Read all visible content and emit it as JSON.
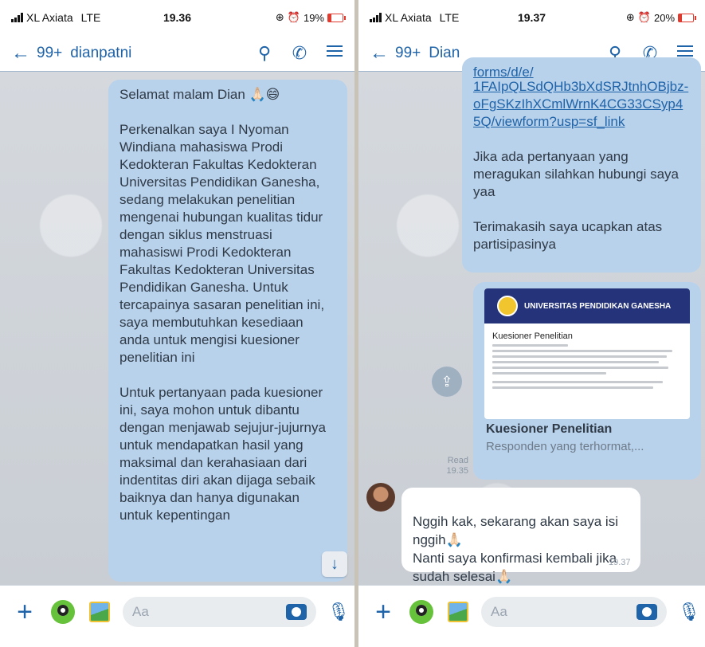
{
  "left": {
    "status": {
      "carrier": "XL Axiata",
      "network": "LTE",
      "time": "19.36",
      "battery": "19%"
    },
    "header": {
      "back_count": "99+",
      "contact": "dianpatni"
    },
    "messages": [
      "Selamat malam Dian 🙏🏻😄",
      "Perkenalkan saya I Nyoman Windiana mahasiswa Prodi Kedokteran Fakultas Kedokteran Universitas Pendidikan Ganesha, sedang melakukan penelitian mengenai hubungan kualitas tidur dengan siklus menstruasi mahasiswi Prodi Kedokteran Fakultas Kedokteran Universitas Pendidikan Ganesha. Untuk tercapainya sasaran penelitian ini, saya membutuhkan kesediaan anda untuk mengisi kuesioner penelitian ini",
      "Untuk pertanyaan pada kuesioner ini, saya mohon untuk dibantu dengan menjawab sejujur-jujurnya untuk mendapatkan hasil yang maksimal dan kerahasiaan dari indentitas diri akan dijaga sebaik baiknya dan hanya digunakan untuk kepentingan"
    ],
    "compose": {
      "placeholder": "Aa"
    }
  },
  "right": {
    "status": {
      "carrier": "XL Axiata",
      "network": "LTE",
      "time": "19.37",
      "battery": "20%"
    },
    "header": {
      "back_count": "99+",
      "contact": "Dian"
    },
    "messages": {
      "link_partial_top": "forms/d/e/",
      "link": "1FAIpQLSdQHb3bXdSRJtnhOBjbz-oFgSKzIhXCmlWrnK4CG33CSyp45Q/viewform?usp=sf_link",
      "para1": "Jika ada pertanyaan yang meragukan silahkan hubungi saya yaa",
      "para2": "Terimakasih saya ucapkan atas partisipasinya"
    },
    "card": {
      "banner": "UNIVERSITAS PENDIDIKAN GANESHA",
      "doc_title": "Kuesioner Penelitian",
      "title": "Kuesioner Penelitian",
      "subtitle": "Responden yang terhormat,..."
    },
    "receipt": {
      "label": "Read",
      "time": "19.35"
    },
    "reply": {
      "text": "Nggih kak, sekarang akan saya isi nggih🙏🏻\nNanti saya konfirmasi kembali jika sudah selesai🙏🏻",
      "time": "19.37"
    },
    "compose": {
      "placeholder": "Aa"
    }
  },
  "colors": {
    "accent": "#1f63a8",
    "bubble_out": "#b9d2ec",
    "bubble_in": "#ffffff"
  }
}
